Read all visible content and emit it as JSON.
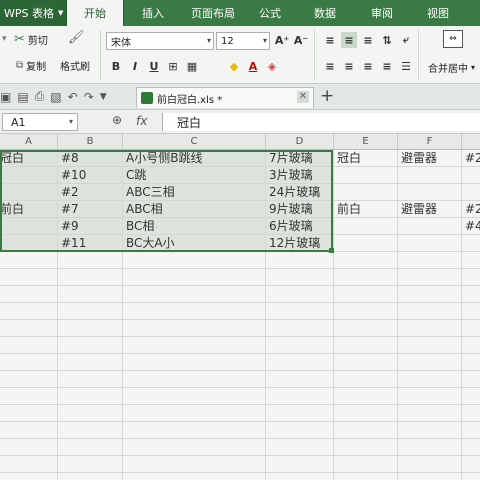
{
  "menubar": {
    "app_label": "WPS 表格",
    "tabs": [
      {
        "label": "开始",
        "active": true
      },
      {
        "label": "插入",
        "active": false
      },
      {
        "label": "页面布局",
        "active": false
      },
      {
        "label": "公式",
        "active": false
      },
      {
        "label": "数据",
        "active": false
      },
      {
        "label": "审阅",
        "active": false
      },
      {
        "label": "视图",
        "active": false
      }
    ]
  },
  "ribbon": {
    "cut": "剪切",
    "copy": "复制",
    "format_painter": "格式刷",
    "font_name": "宋体",
    "font_size": "12",
    "merge_center": "合并居中"
  },
  "doc": {
    "tab_title": "前白冠白.xls *"
  },
  "formula_bar": {
    "name_box": "A1",
    "fx_label": "fx",
    "content": "冠白"
  },
  "sheet": {
    "columns": [
      "A",
      "B",
      "C",
      "D",
      "E",
      "F"
    ],
    "rows": [
      [
        "冠白",
        "#8",
        "A小号侧B跳线",
        "7片玻璃",
        "冠白",
        "避雷器",
        "#2"
      ],
      [
        "",
        "#10",
        "C跳",
        "3片玻璃",
        "",
        "",
        ""
      ],
      [
        "",
        "#2",
        "ABC三相",
        "24片玻璃",
        "",
        "",
        ""
      ],
      [
        "前白",
        "#7",
        "ABC相",
        "9片玻璃",
        "前白",
        "避雷器",
        "#2"
      ],
      [
        "",
        "#9",
        "BC相",
        "6片玻璃",
        "",
        "",
        "#4"
      ],
      [
        "",
        "#11",
        "BC大A小",
        "12片玻璃",
        "",
        "",
        ""
      ],
      [
        "",
        "",
        "",
        "",
        "",
        "",
        ""
      ],
      [
        "",
        "",
        "",
        "",
        "",
        "",
        ""
      ],
      [
        "",
        "",
        "",
        "",
        "",
        "",
        ""
      ],
      [
        "",
        "",
        "",
        "",
        "",
        "",
        ""
      ],
      [
        "",
        "",
        "",
        "",
        "",
        "",
        ""
      ],
      [
        "",
        "",
        "",
        "",
        "",
        "",
        ""
      ],
      [
        "",
        "",
        "",
        "",
        "",
        "",
        ""
      ],
      [
        "",
        "",
        "",
        "",
        "",
        "",
        ""
      ],
      [
        "",
        "",
        "",
        "",
        "",
        "",
        ""
      ],
      [
        "",
        "",
        "",
        "",
        "",
        "",
        ""
      ],
      [
        "",
        "",
        "",
        "",
        "",
        "",
        ""
      ],
      [
        "",
        "",
        "",
        "",
        "",
        "",
        ""
      ],
      [
        "",
        "",
        "",
        "",
        "",
        "",
        ""
      ],
      [
        "",
        "",
        "",
        "",
        "",
        "",
        ""
      ]
    ]
  },
  "colors": {
    "menubar_bg": "#3a7a44",
    "selection_border": "#3c7a45"
  }
}
